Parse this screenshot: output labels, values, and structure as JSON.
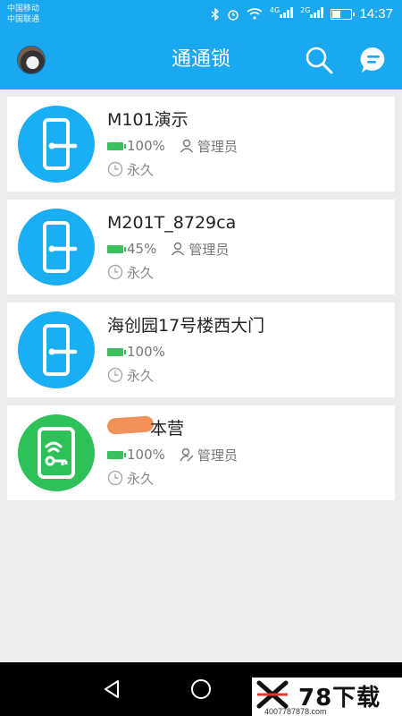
{
  "status_bar": {
    "carrier_1": "中国移动",
    "carrier_2": "中国联通",
    "net_1": "4G",
    "net_2": "2G",
    "time": "14:37"
  },
  "app_bar": {
    "title": "通通锁",
    "search_icon": "search-icon",
    "message_icon": "chat-bubble-icon"
  },
  "locks": [
    {
      "name": "M101演示",
      "battery": "100%",
      "role": "管理员",
      "period": "永久",
      "icon": "door-lock-icon",
      "color": "#1aaef5"
    },
    {
      "name": "M201T_8729ca",
      "battery": "45%",
      "role": "管理员",
      "period": "永久",
      "icon": "door-lock-icon",
      "color": "#1aaef5"
    },
    {
      "name": "海创园17号楼西大门",
      "battery": "100%",
      "period": "永久",
      "icon": "door-lock-icon",
      "color": "#1aaef5"
    },
    {
      "name": "本营",
      "battery": "100%",
      "role": "管理员",
      "period": "永久",
      "icon": "wireless-key-icon",
      "color": "#2ec159"
    }
  ],
  "watermark": {
    "brand": "78下载",
    "phone": "4007787878.com"
  },
  "colors": {
    "primary": "#1aa8f0",
    "battery": "#3bbf5c",
    "card_bg": "#ffffff",
    "page_bg": "#ececec"
  }
}
